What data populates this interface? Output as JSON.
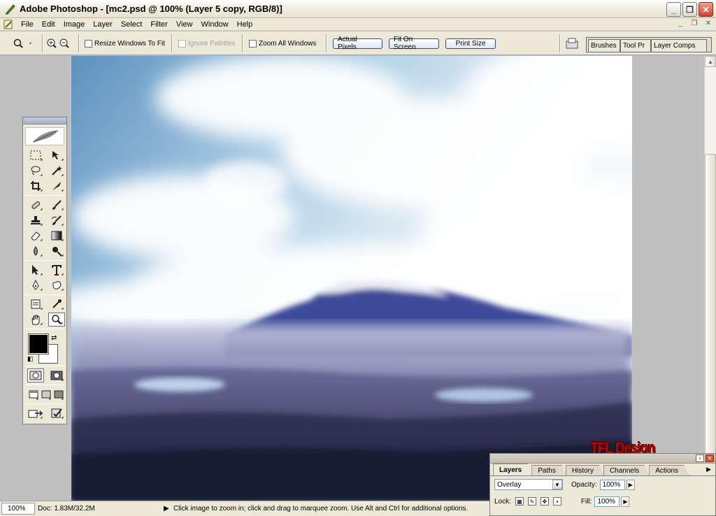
{
  "window": {
    "title": "Adobe Photoshop - [mc2.psd @ 100% (Layer 5 copy, RGB/8)]",
    "minimize_glyph": "_",
    "maximize_glyph": "❐",
    "close_glyph": "✕"
  },
  "menu": {
    "items": [
      "File",
      "Edit",
      "Image",
      "Layer",
      "Select",
      "Filter",
      "View",
      "Window",
      "Help"
    ]
  },
  "options_bar": {
    "resize_windows": "Resize Windows To Fit",
    "ignore_palettes": "Ignore Palettes",
    "zoom_all": "Zoom All Windows",
    "actual_pixels": "Actual Pixels",
    "fit_on_screen": "Fit On Screen",
    "print_size": "Print Size"
  },
  "palette_well": {
    "tabs": [
      "Brushes",
      "Tool Pr",
      "Layer Comps"
    ]
  },
  "status_bar": {
    "zoom": "100%",
    "doc": "Doc: 1.83M/32.2M",
    "hint": "Click image to zoom in; click and drag to marquee zoom.  Use Alt and Ctrl for additional options."
  },
  "layers_palette": {
    "tabs": [
      "Layers",
      "Paths",
      "History",
      "Channels",
      "Actions"
    ],
    "blend_mode": "Overlay",
    "opacity_label": "Opacity:",
    "opacity_value": "100%",
    "lock_label": "Lock:",
    "fill_label": "Fill:",
    "fill_value": "100%"
  },
  "canvas": {
    "watermark": "TFL Design"
  },
  "colors": {
    "foreground": "#000000",
    "background": "#ffffff"
  }
}
